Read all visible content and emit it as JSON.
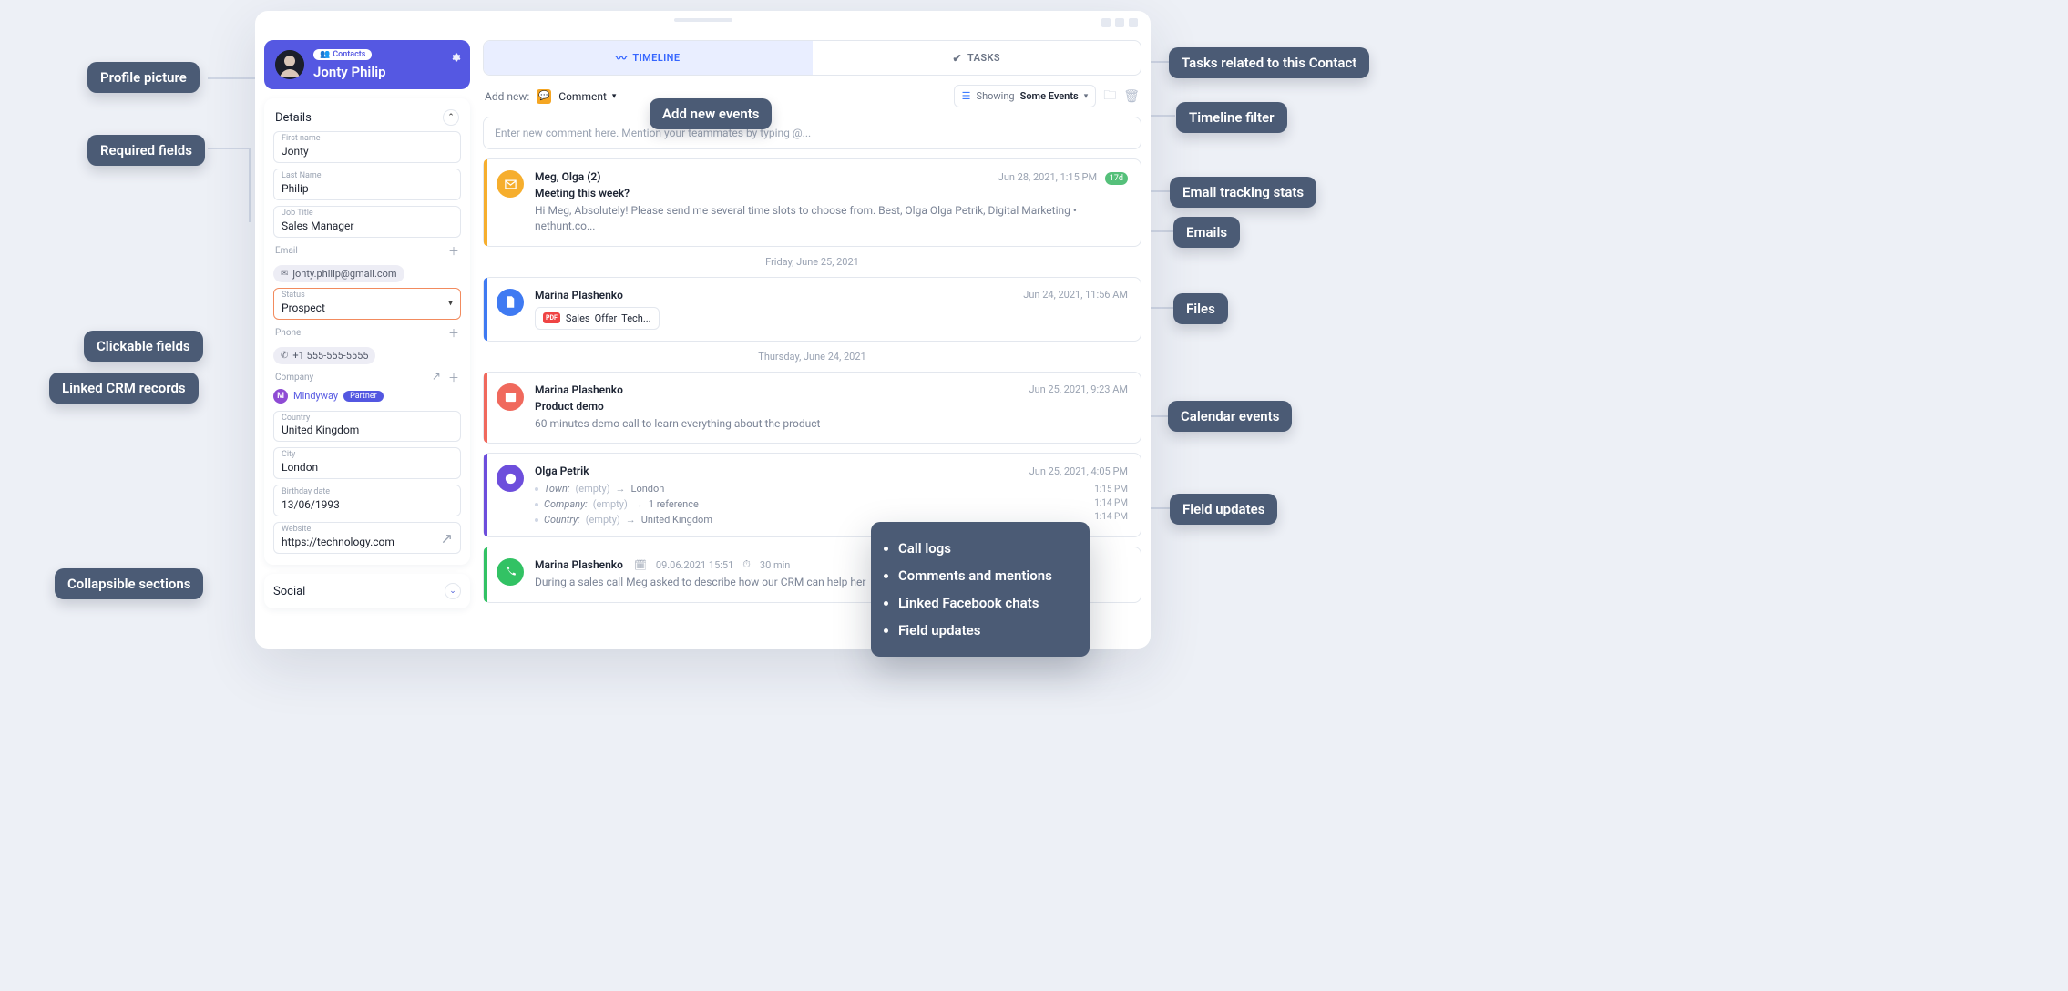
{
  "sidebar": {
    "badge_icon": "people",
    "badge_label": "Contacts",
    "contact_name": "Jonty Philip",
    "sections": {
      "details_title": "Details",
      "social_title": "Social"
    },
    "fields": {
      "first_name": {
        "label": "First name",
        "value": "Jonty"
      },
      "last_name": {
        "label": "Last Name",
        "value": "Philip"
      },
      "job_title": {
        "label": "Job Title",
        "value": "Sales Manager"
      },
      "email_header": "Email",
      "email_value": "jonty.philip@gmail.com",
      "status": {
        "label": "Status",
        "value": "Prospect"
      },
      "phone_header": "Phone",
      "phone_value": "+1 555-555-5555",
      "company_header": "Company",
      "company_initial": "M",
      "company_name": "Mindyway",
      "company_tag": "Partner",
      "country": {
        "label": "Country",
        "value": "United Kingdom"
      },
      "city": {
        "label": "City",
        "value": "London"
      },
      "birthday": {
        "label": "Birthday date",
        "value": "13/06/1993"
      },
      "website": {
        "label": "Website",
        "value": "https://technology.com"
      }
    }
  },
  "tabs": {
    "timeline": "TIMELINE",
    "tasks": "TASKS"
  },
  "toolbar": {
    "add_new_label": "Add new:",
    "comment_label": "Comment",
    "showing_label": "Showing",
    "showing_value": "Some Events"
  },
  "comment_placeholder": "Enter new comment here. Mention your teammates by typing @...",
  "feed": {
    "email": {
      "who": "Meg, Olga (2)",
      "when": "Jun 28, 2021, 1:15 PM",
      "badge": "17d",
      "subject": "Meeting this week?",
      "preview": "Hi Meg, Absolutely! Please send me several time slots to choose from. Best, Olga Olga Petrik, Digital Marketing • nethunt.co..."
    },
    "sep1": "Friday, June 25, 2021",
    "file": {
      "who": "Marina Plashenko",
      "when": "Jun 24, 2021, 11:56 AM",
      "filename": "Sales_Offer_Tech..."
    },
    "sep2": "Thursday, June 24, 2021",
    "cal": {
      "who": "Marina Plashenko",
      "when": "Jun 25, 2021, 9:23 AM",
      "title": "Product demo",
      "body": "60 minutes demo call to learn everything about the product"
    },
    "update": {
      "who": "Olga Petrik",
      "when": "Jun 25, 2021, 4:05 PM",
      "t1": "1:15 PM",
      "t2": "1:14 PM",
      "t3": "1:14 PM",
      "c1_key": "Town:",
      "c1_old": "(empty)",
      "c1_new": "London",
      "c2_key": "Company:",
      "c2_old": "(empty)",
      "c2_new": "1 reference",
      "c3_key": "Country:",
      "c3_old": "(empty)",
      "c3_new": "United Kingdom"
    },
    "call": {
      "who": "Marina Plashenko",
      "date": "09.06.2021 15:51",
      "dur": "30 min",
      "body": "During a sales call Meg asked to describe how our CRM can help her"
    }
  },
  "overlay": {
    "i1": "Call logs",
    "i2": "Comments and mentions",
    "i3": "Linked Facebook chats",
    "i4": "Field updates"
  },
  "callouts": {
    "profile_picture": "Profile picture",
    "required_fields": "Required fields",
    "clickable_fields": "Clickable fields",
    "linked_crm": "Linked CRM records",
    "collapsible": "Collapsible sections",
    "add_new_events": "Add new events",
    "tasks_related": "Tasks related to this Contact",
    "timeline_filter": "Timeline filter",
    "email_stats": "Email tracking stats",
    "emails": "Emails",
    "files": "Files",
    "calendar": "Calendar events",
    "field_updates": "Field updates"
  }
}
